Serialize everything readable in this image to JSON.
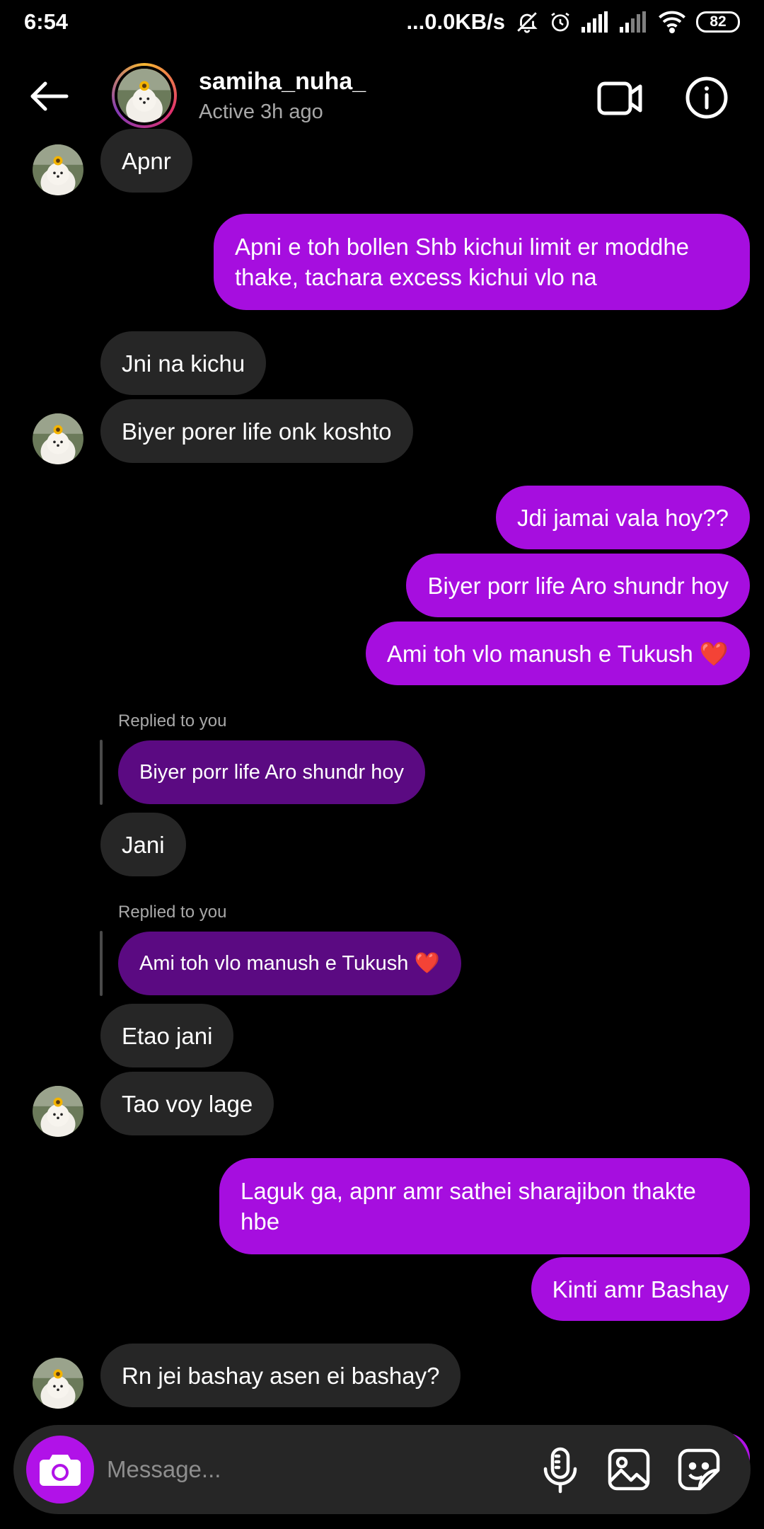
{
  "status_bar": {
    "time": "6:54",
    "network_speed": "...0.0KB/s",
    "battery": "82"
  },
  "header": {
    "username": "samiha_nuha_",
    "activity": "Active 3h ago"
  },
  "messages": [
    {
      "side": "in",
      "text": "Apnr"
    },
    {
      "side": "out",
      "text": "Apni e toh bollen Shb kichui limit er moddhe thake, tachara excess kichui vlo na"
    },
    {
      "side": "in",
      "text": "Jni na kichu"
    },
    {
      "side": "in",
      "text": "Biyer porer life onk koshto"
    },
    {
      "side": "out",
      "text": "Jdi jamai vala hoy??"
    },
    {
      "side": "out",
      "text": "Biyer porr life Aro shundr hoy"
    },
    {
      "side": "out",
      "text": "Ami toh vlo manush e Tukush ❤️"
    },
    {
      "side": "in",
      "replied_label": "Replied to you",
      "quoted": "Biyer porr life Aro shundr hoy",
      "text": "Jani"
    },
    {
      "side": "in",
      "replied_label": "Replied to you",
      "quoted": "Ami toh vlo manush e Tukush ❤️",
      "text": "Etao jani"
    },
    {
      "side": "in",
      "text": "Tao voy lage"
    },
    {
      "side": "out",
      "text": "Laguk ga, apnr amr sathei sharajibon thakte hbe"
    },
    {
      "side": "out",
      "text": "Kinti amr Bashay"
    },
    {
      "side": "in",
      "text": "Rn jei bashay asen ei bashay?"
    }
  ],
  "composer": {
    "placeholder": "Message..."
  },
  "colors": {
    "outgoing_bubble": "#a60edf",
    "incoming_bubble": "#262626",
    "reply_quote": "#5b0a82",
    "accent": "#b112e8"
  },
  "icons": {
    "back": "back-arrow-icon",
    "video": "video-call-icon",
    "info": "info-icon",
    "camera": "camera-icon",
    "mic": "microphone-icon",
    "gallery": "gallery-icon",
    "sticker": "sticker-icon"
  }
}
